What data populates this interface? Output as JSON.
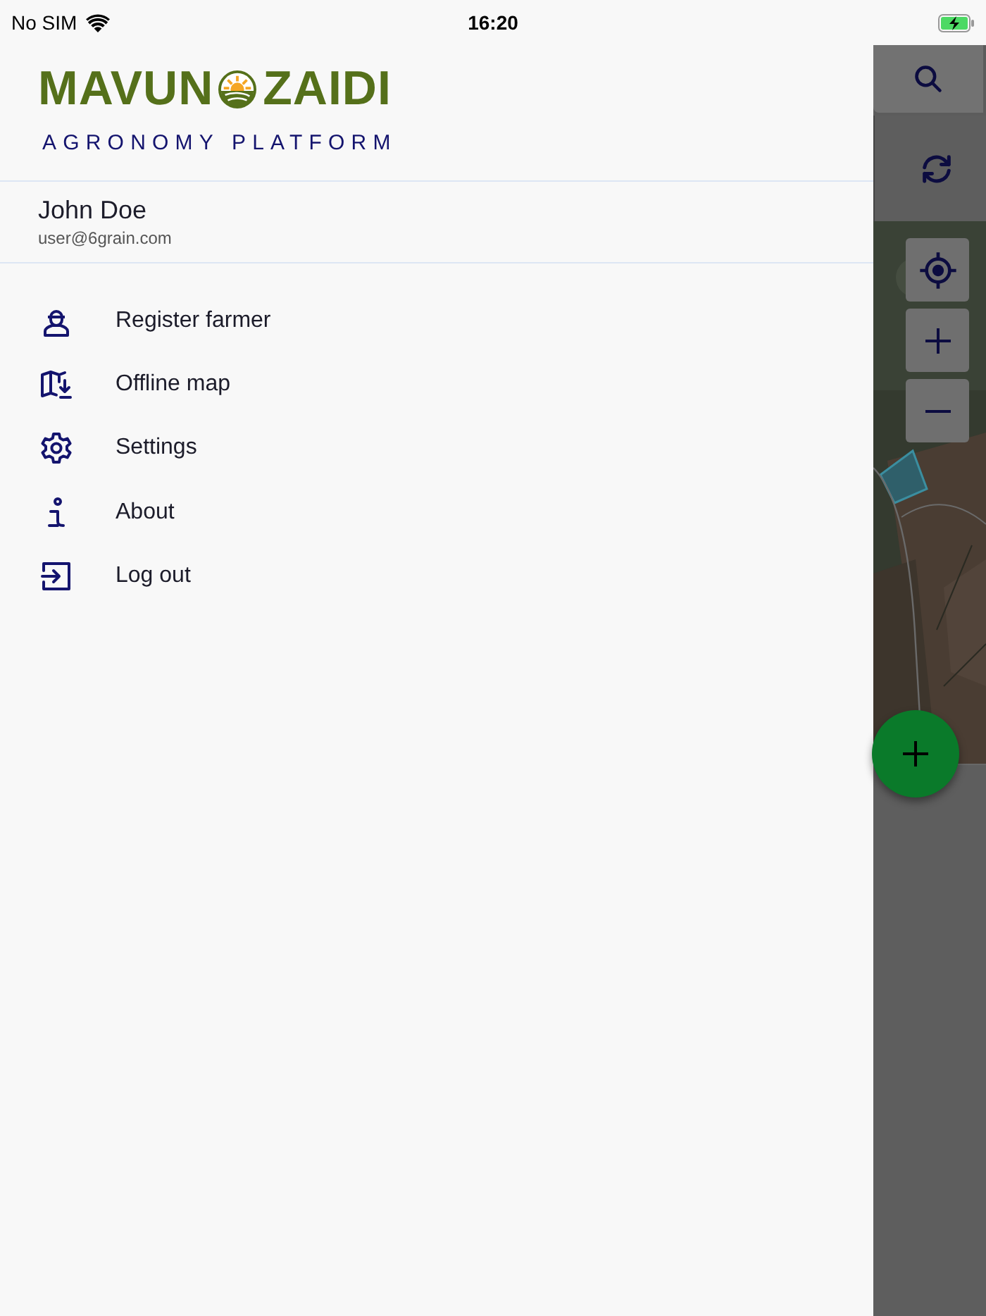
{
  "status_bar": {
    "carrier": "No SIM",
    "time": "16:20"
  },
  "drawer": {
    "logo": {
      "left": "MAVUN",
      "right": "ZAIDI",
      "subtitle": "AGRONOMY PLATFORM"
    },
    "user": {
      "name": "John Doe",
      "email": "user@6grain.com"
    },
    "items": [
      {
        "kind": "farmer",
        "label": "Register farmer"
      },
      {
        "kind": "offline-map",
        "label": "Offline map"
      },
      {
        "kind": "settings",
        "label": "Settings"
      },
      {
        "kind": "about",
        "label": "About"
      },
      {
        "kind": "logout",
        "label": "Log out"
      }
    ]
  }
}
